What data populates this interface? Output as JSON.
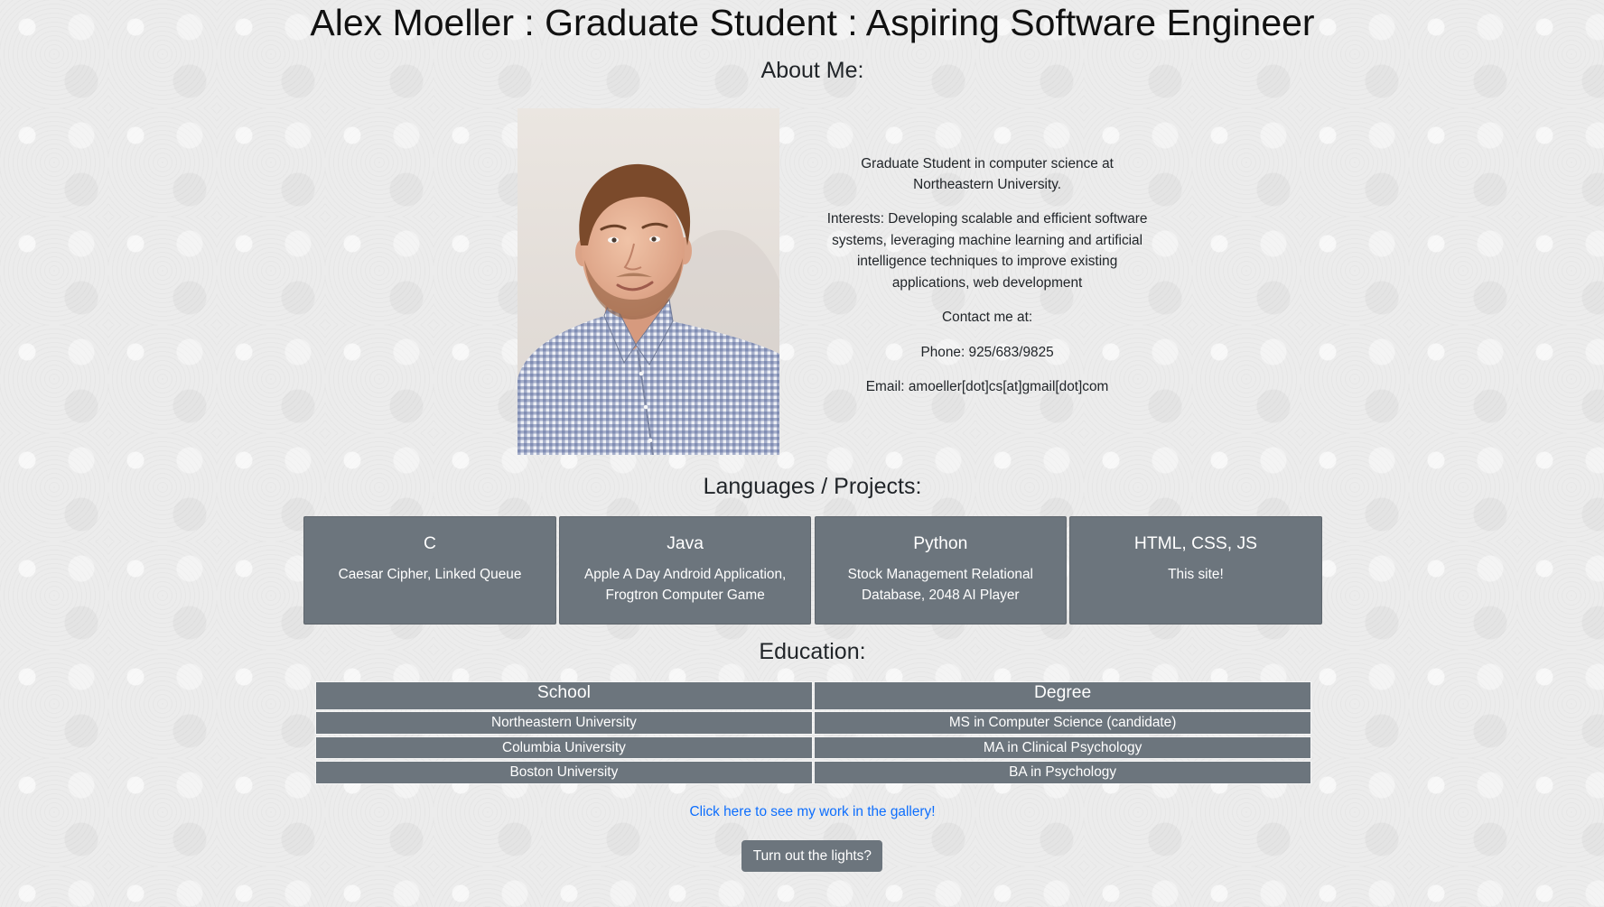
{
  "header": {
    "title": "Alex Moeller : Graduate Student : Aspiring Software Engineer"
  },
  "about": {
    "heading": "About Me:",
    "bio": "Graduate Student in computer science at Northeastern University.",
    "interests": "Interests: Developing scalable and efficient software systems, leveraging machine learning and artificial intelligence techniques to improve existing applications, web development",
    "contact_label": "Contact me at:",
    "phone": "Phone: 925/683/9825",
    "email": "Email: amoeller[dot]cs[at]gmail[dot]com"
  },
  "projects": {
    "heading": "Languages / Projects:",
    "cards": [
      {
        "language": "C",
        "projects": "Caesar Cipher, Linked Queue"
      },
      {
        "language": "Java",
        "projects": "Apple A Day Android Application, Frogtron Computer Game"
      },
      {
        "language": "Python",
        "projects": "Stock Management Relational Database, 2048 AI Player"
      },
      {
        "language": "HTML, CSS, JS",
        "projects": "This site!"
      }
    ]
  },
  "education": {
    "heading": "Education:",
    "columns": [
      "School",
      "Degree"
    ],
    "rows": [
      [
        "Northeastern University",
        "MS in Computer Science (candidate)"
      ],
      [
        "Columbia University",
        "MA in Clinical Psychology"
      ],
      [
        "Boston University",
        "BA in Psychology"
      ]
    ]
  },
  "gallery_link": {
    "label": "Click here to see my work in the gallery!"
  },
  "lights_toggle": {
    "label": "Turn out the lights?"
  },
  "colors": {
    "card_background": "#6c757d",
    "link": "#0d6efd",
    "text": "#212529",
    "page_background": "#ececec"
  }
}
